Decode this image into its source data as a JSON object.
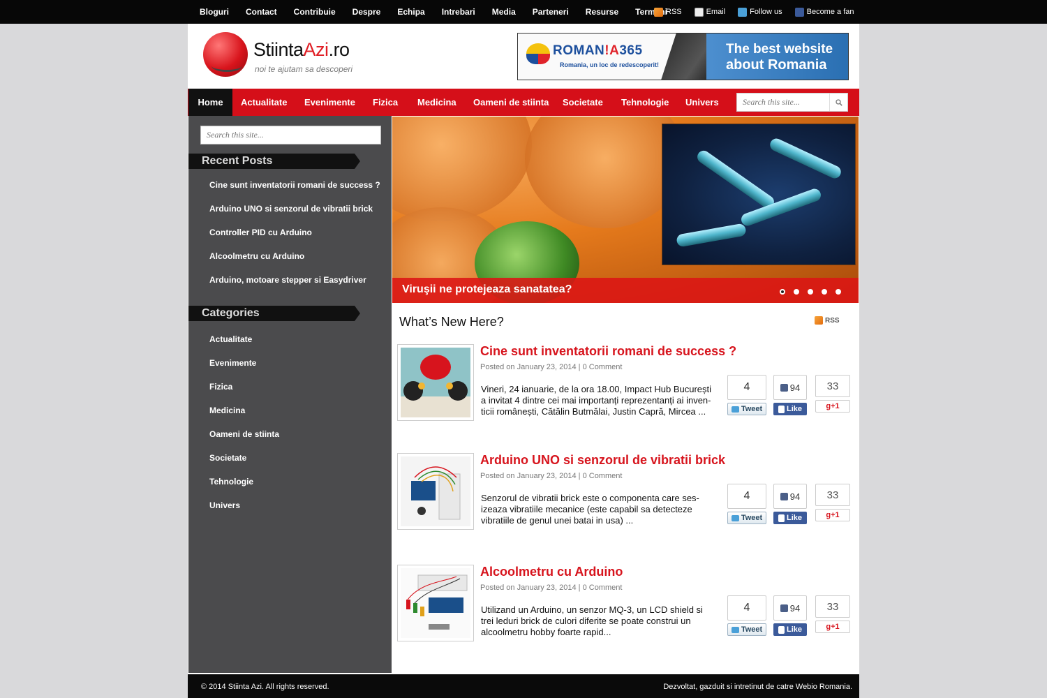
{
  "topbar": {
    "menu": [
      "Bloguri",
      "Contact",
      "Contribuie",
      "Despre",
      "Echipa",
      "Intrebari",
      "Media",
      "Parteneri",
      "Resurse",
      "Termeni"
    ],
    "social": [
      {
        "label": "RSS",
        "icon": "rss-icon"
      },
      {
        "label": "Email",
        "icon": "email-icon"
      },
      {
        "label": "Follow us",
        "icon": "twitter-icon"
      },
      {
        "label": "Become a fan",
        "icon": "facebook-icon"
      }
    ]
  },
  "header": {
    "logo_name_main": "Stiinta",
    "logo_name_accent": "Azi",
    "logo_name_suffix": ".ro",
    "tagline": "noi te ajutam sa descoperi",
    "banner": {
      "brand_a": "ROMAN",
      "brand_b": "!A",
      "brand_c": "365",
      "sub": "Romania, un loc de redescoperit!",
      "line1": "The best website",
      "line2": "about Romania"
    }
  },
  "nav": {
    "items": [
      "Home",
      "Actualitate",
      "Evenimente",
      "Fizica",
      "Medicina",
      "Oameni de stiinta",
      "Societate",
      "Tehnologie",
      "Univers"
    ],
    "active": "Home",
    "search_placeholder": "Search this site..."
  },
  "sidebar": {
    "search_placeholder": "Search this site...",
    "recent_title": "Recent Posts",
    "recent": [
      "Cine sunt inventatorii romani de success ?",
      "Arduino UNO si senzorul de vibratii brick",
      "Controller PID cu Arduino",
      "Alcoolmetru cu Arduino",
      "Arduino, motoare stepper si Easydriver"
    ],
    "categories_title": "Categories",
    "categories": [
      "Actualitate",
      "Evenimente",
      "Fizica",
      "Medicina",
      "Oameni de stiinta",
      "Societate",
      "Tehnologie",
      "Univers"
    ]
  },
  "slider": {
    "caption": "Viruşii ne protejeaza sanatatea?",
    "slide_count": 5,
    "active_slide": 1
  },
  "content": {
    "heading": "What’s New Here?",
    "rss_label": "RSS",
    "posts": [
      {
        "title": "Cine sunt inventatorii romani de success ?",
        "meta": "Posted on January 23, 2014 | 0 Comment",
        "excerpt": "Vineri, 24 ianuarie, de la ora 18.00, Impact Hub București a invitat 4 dintre cei mai importanți reprezentanți ai inven- ticii românești, Cătălin Butmălai, Justin Capră, Mircea ...",
        "tweets": "4",
        "tweet_label": "Tweet",
        "likes": "94",
        "like_label": "Like",
        "plus": "33",
        "plus_label": "+1"
      },
      {
        "title": "Arduino UNO si senzorul de vibratii brick",
        "meta": "Posted on January 23, 2014 | 0 Comment",
        "excerpt": "Senzorul de vibratii brick este o componenta care ses- izeaza vibratiile mecanice (este capabil sa detecteze vibratiile de genul unei batai in usa) ...",
        "tweets": "4",
        "tweet_label": "Tweet",
        "likes": "94",
        "like_label": "Like",
        "plus": "33",
        "plus_label": "+1"
      },
      {
        "title": "Alcoolmetru cu Arduino",
        "meta": "Posted on January 23, 2014 | 0 Comment",
        "excerpt": "Utilizand un Arduino, un senzor MQ-3, un LCD shield si trei leduri brick de culori diferite se poate construi un alcoolmetru hobby foarte rapid...",
        "tweets": "4",
        "tweet_label": "Tweet",
        "likes": "94",
        "like_label": "Like",
        "plus": "33",
        "plus_label": "+1"
      }
    ]
  },
  "footer": {
    "left": "© 2014 Stiinta Azi. All rights reserved.",
    "right": "Dezvoltat, gazduit si intretinut de catre Webio Romania."
  },
  "colors": {
    "accent_red": "#d50f19",
    "sidebar_bg": "#4b4b4d",
    "topbar_bg": "#070707"
  }
}
